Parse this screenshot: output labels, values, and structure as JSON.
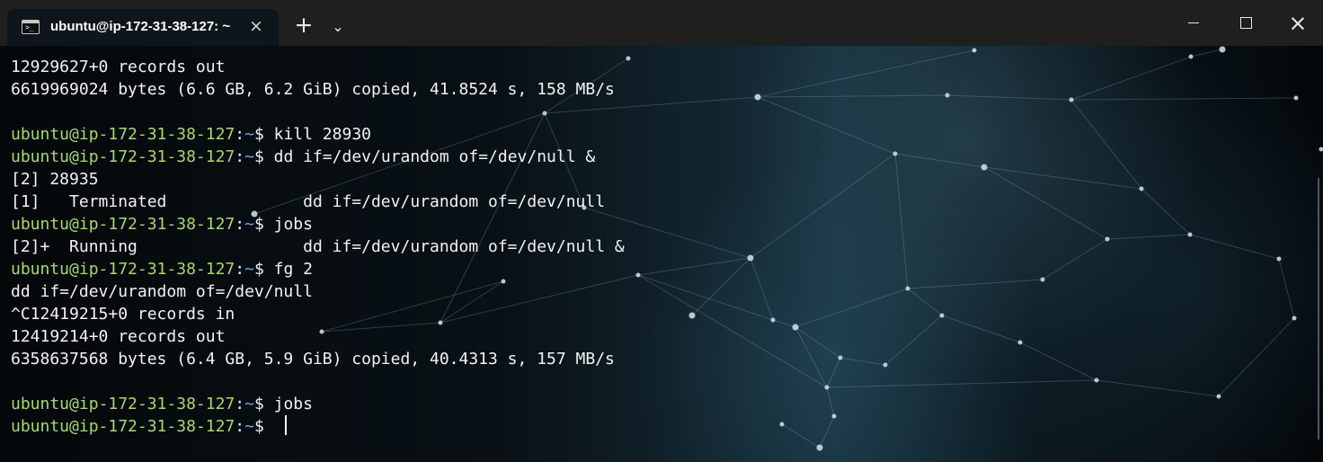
{
  "tab": {
    "title": "ubuntu@ip-172-31-38-127: ~",
    "icon": "terminal-icon",
    "close": "×"
  },
  "toolbar": {
    "new_tab": "+",
    "dropdown": "⌄"
  },
  "window_controls": {
    "close": "×"
  },
  "terminal": {
    "lines": [
      {
        "type": "text",
        "text": "12929627+0 records out"
      },
      {
        "type": "text",
        "text": "6619969024 bytes (6.6 GB, 6.2 GiB) copied, 41.8524 s, 158 MB/s"
      },
      {
        "type": "blank",
        "text": ""
      },
      {
        "type": "prompt",
        "user": "ubuntu@ip-172-31-38-127",
        "colon": ":",
        "path": "~",
        "symbol": "$ ",
        "command": "kill 28930"
      },
      {
        "type": "prompt",
        "user": "ubuntu@ip-172-31-38-127",
        "colon": ":",
        "path": "~",
        "symbol": "$ ",
        "command": "dd if=/dev/urandom of=/dev/null &"
      },
      {
        "type": "text",
        "text": "[2] 28935"
      },
      {
        "type": "text",
        "text": "[1]   Terminated              dd if=/dev/urandom of=/dev/null"
      },
      {
        "type": "prompt",
        "user": "ubuntu@ip-172-31-38-127",
        "colon": ":",
        "path": "~",
        "symbol": "$ ",
        "command": "jobs"
      },
      {
        "type": "text",
        "text": "[2]+  Running                 dd if=/dev/urandom of=/dev/null &"
      },
      {
        "type": "prompt",
        "user": "ubuntu@ip-172-31-38-127",
        "colon": ":",
        "path": "~",
        "symbol": "$ ",
        "command": "fg 2"
      },
      {
        "type": "text",
        "text": "dd if=/dev/urandom of=/dev/null"
      },
      {
        "type": "text",
        "text": "^C12419215+0 records in"
      },
      {
        "type": "text",
        "text": "12419214+0 records out"
      },
      {
        "type": "text",
        "text": "6358637568 bytes (6.4 GB, 5.9 GiB) copied, 40.4313 s, 157 MB/s"
      },
      {
        "type": "blank",
        "text": ""
      },
      {
        "type": "prompt",
        "user": "ubuntu@ip-172-31-38-127",
        "colon": ":",
        "path": "~",
        "symbol": "$ ",
        "command": "jobs"
      },
      {
        "type": "prompt",
        "user": "ubuntu@ip-172-31-38-127",
        "colon": ":",
        "path": "~",
        "symbol": "$ ",
        "command": "",
        "cursor": true
      }
    ]
  },
  "colors": {
    "prompt_user": "#a7d86f",
    "prompt_path": "#5ea7ff",
    "text": "#f2f2f2",
    "titlebar": "#1f1f1f"
  }
}
